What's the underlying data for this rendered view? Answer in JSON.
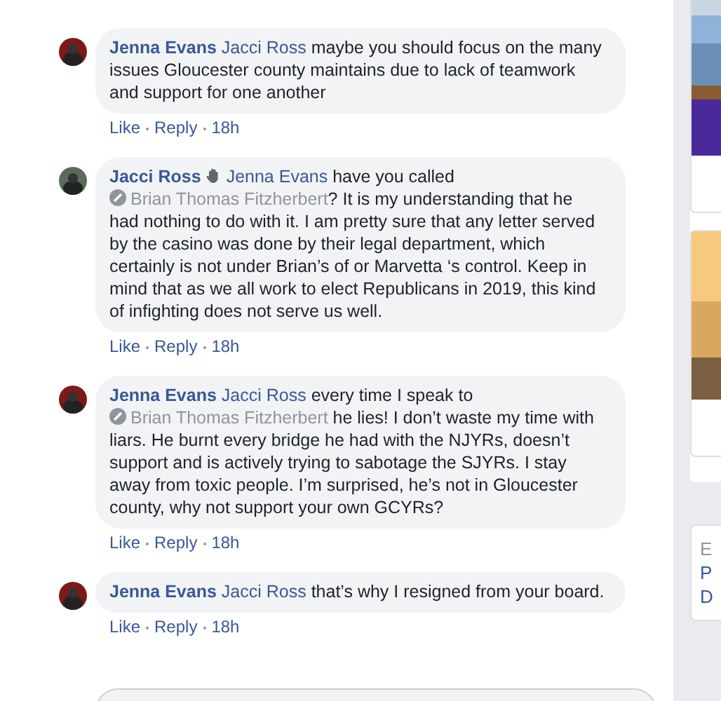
{
  "comments": [
    {
      "author": "Jenna Evans",
      "badge": false,
      "body": [
        {
          "kind": "mention",
          "text": "Jacci Ross"
        },
        {
          "kind": "text",
          "text": " maybe you should focus on the many issues Gloucester county maintains due to lack of teamwork and support for one another"
        }
      ],
      "actions": [
        "Like",
        "Reply"
      ],
      "time": "18h"
    },
    {
      "author": "Jacci Ross",
      "badge": true,
      "body": [
        {
          "kind": "mention",
          "text": "Jenna Evans"
        },
        {
          "kind": "text",
          "text": " have you called "
        },
        {
          "kind": "inactive_mention",
          "text": "Brian Thomas Fitzherbert"
        },
        {
          "kind": "text",
          "text": "? It is my understanding that he had nothing to do with it. I am pretty sure that any letter served by the casino was done by their legal department, which certainly is not under Brian’s of or Marvetta ‘s control. Keep in mind that as we all work to elect Republicans in 2019, this kind of infighting does not serve us well."
        }
      ],
      "actions": [
        "Like",
        "Reply"
      ],
      "time": "18h"
    },
    {
      "author": "Jenna Evans",
      "badge": false,
      "body": [
        {
          "kind": "mention",
          "text": "Jacci Ross"
        },
        {
          "kind": "text",
          "text": " every time I speak to "
        },
        {
          "kind": "inactive_mention",
          "text": "Brian Thomas Fitzherbert"
        },
        {
          "kind": "text",
          "text": " he lies! I don’t waste my time with liars. He burnt every bridge he had with the NJYRs, doesn’t support and is actively trying to sabotage the SJYRs. I stay away from toxic people. I’m surprised, he’s not in Gloucester county, why not support your own GCYRs?"
        }
      ],
      "actions": [
        "Like",
        "Reply"
      ],
      "time": "18h"
    },
    {
      "author": "Jenna Evans",
      "badge": false,
      "body": [
        {
          "kind": "mention",
          "text": "Jacci Ross"
        },
        {
          "kind": "text",
          "text": " that’s why I resigned from your board."
        }
      ],
      "actions": [
        "Like",
        "Reply"
      ],
      "time": "18h"
    }
  ],
  "sidebar": {
    "bottom_card": {
      "lines": [
        "E",
        "P",
        "D"
      ]
    }
  }
}
